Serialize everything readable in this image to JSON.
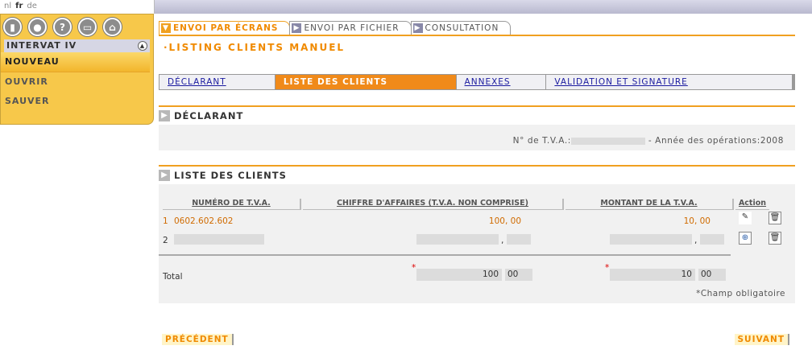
{
  "languages": [
    {
      "code": "nl",
      "active": false
    },
    {
      "code": "fr",
      "active": true
    },
    {
      "code": "de",
      "active": false
    }
  ],
  "sidebar": {
    "title": "INTERVAT IV",
    "icons": [
      "door-icon",
      "user-icon",
      "help-icon",
      "print-icon",
      "home-icon"
    ],
    "items": [
      {
        "label": "NOUVEAU",
        "selected": true
      },
      {
        "label": "OUVRIR",
        "selected": false
      },
      {
        "label": "SAUVER",
        "selected": false
      }
    ]
  },
  "tabs": [
    {
      "label": "ENVOI PAR ÉCRANS",
      "active": true
    },
    {
      "label": "ENVOI PAR FICHIER",
      "active": false
    },
    {
      "label": "CONSULTATION",
      "active": false
    }
  ],
  "page_title": "·LISTING CLIENTS MANUEL",
  "subtabs": [
    {
      "label": "DÉCLARANT",
      "active": false
    },
    {
      "label": "LISTE DES CLIENTS",
      "active": true
    },
    {
      "label": "ANNEXES",
      "active": false
    },
    {
      "label": "VALIDATION ET SIGNATURE",
      "active": false
    }
  ],
  "declarant": {
    "title": "DÉCLARANT",
    "tva_label": "N° de T.V.A.:",
    "year_label": " - Année des opérations:",
    "year": "2008"
  },
  "clients": {
    "title": "LISTE DES CLIENTS",
    "headers": [
      "NUMÉRO DE T.V.A.",
      "CHIFFRE D'AFFAIRES (T.V.A. NON COMPRISE)",
      "MONTANT DE LA T.V.A.",
      "Action"
    ],
    "rows": [
      {
        "num": "1",
        "tva": "0602.602.602",
        "turnover": "100, 00",
        "vat": "10, 00"
      },
      {
        "num": "2",
        "tva": "",
        "turnover": "",
        "vat": ""
      }
    ],
    "total_label": "Total",
    "total_turnover": "100",
    "total_turnover_dec": "00",
    "total_vat": "10",
    "total_vat_dec": "00",
    "required_mark": "*",
    "required_note": "*Champ obligatoire",
    "separator": ","
  },
  "nav": {
    "prev": "PRÉCÉDENT",
    "next": "SUIVANT"
  },
  "colors": {
    "accent": "#f08a00",
    "panel": "#f7c84a"
  }
}
